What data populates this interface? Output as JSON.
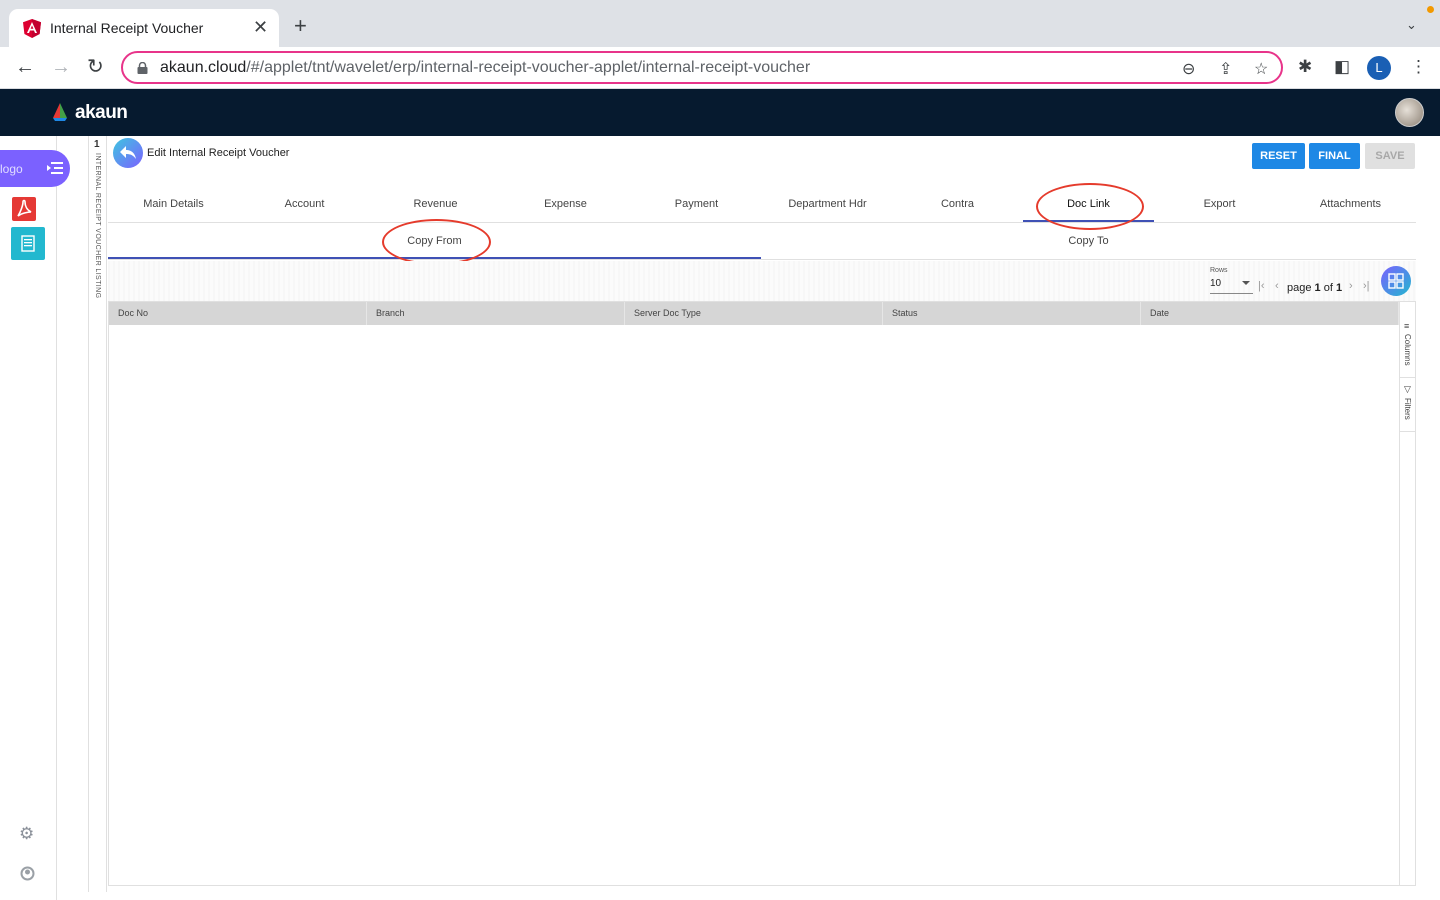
{
  "browser": {
    "tab_title": "Internal Receipt Voucher",
    "url_host": "akaun.cloud",
    "url_path": "/#/applet/tnt/wavelet/erp/internal-receipt-voucher-applet/internal-receipt-voucher",
    "profile_initial": "L",
    "accent_color": "#e8348a"
  },
  "app": {
    "brand": "akaun",
    "header_color": "#061a2f"
  },
  "sidebar": {
    "logo_alt": "logo",
    "items": [
      {
        "icon": "adobe-pdf-app-icon"
      },
      {
        "icon": "document-list-app-icon"
      }
    ],
    "bottom": [
      {
        "icon": "gear-icon"
      },
      {
        "icon": "user-icon"
      }
    ]
  },
  "listing": {
    "number": "1",
    "label": "INTERNAL RECEIPT VOUCHER LISTING"
  },
  "panel": {
    "title": "Edit Internal Receipt Voucher",
    "buttons": {
      "reset": "RESET",
      "final": "FINAL",
      "save": "SAVE"
    }
  },
  "tabs": [
    {
      "label": "Main Details"
    },
    {
      "label": "Account"
    },
    {
      "label": "Revenue"
    },
    {
      "label": "Expense"
    },
    {
      "label": "Payment"
    },
    {
      "label": "Department Hdr"
    },
    {
      "label": "Contra"
    },
    {
      "label": "Doc Link",
      "active": true
    },
    {
      "label": "Export"
    },
    {
      "label": "Attachments"
    }
  ],
  "sub_tabs": [
    {
      "label": "Copy From",
      "active": true
    },
    {
      "label": "Copy To"
    }
  ],
  "pager": {
    "rows_label": "Rows",
    "rows_value": "10",
    "page_word": "page",
    "current_page": "1",
    "of_word": "of",
    "total_pages": "1"
  },
  "grid": {
    "columns": [
      "Doc No",
      "Branch",
      "Server Doc Type",
      "Status",
      "Date"
    ],
    "rows": [],
    "side_panel": [
      "Columns",
      "Filters"
    ]
  }
}
